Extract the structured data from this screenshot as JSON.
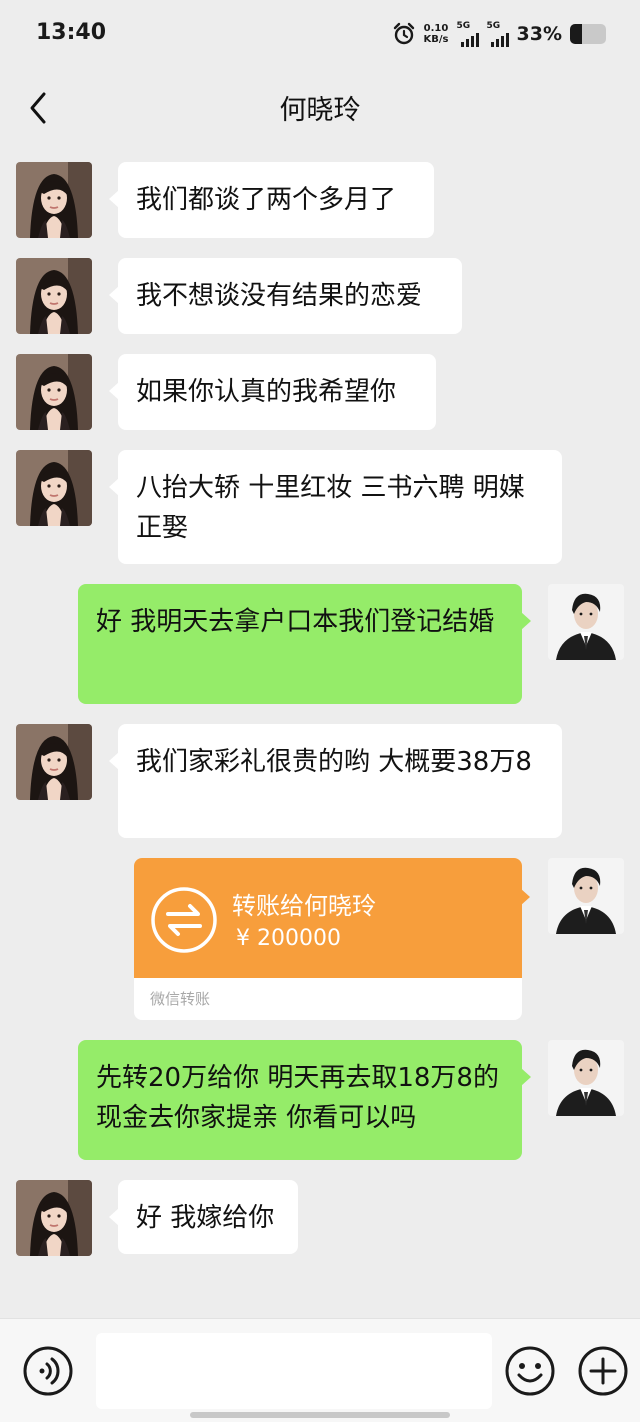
{
  "status_bar": {
    "time": "13:40",
    "net_speed_value": "0.10",
    "net_speed_unit": "KB/s",
    "signal1_label": "5G",
    "signal2_label": "5G",
    "battery_percent": "33%",
    "battery_level": 0.33
  },
  "nav": {
    "title": "何晓玲",
    "back_icon": "chevron-left-icon"
  },
  "messages": [
    {
      "side": "in",
      "text": "我们都谈了两个多月了"
    },
    {
      "side": "in",
      "text": "我不想谈没有结果的恋爱"
    },
    {
      "side": "in",
      "text": "如果你认真的我希望你"
    },
    {
      "side": "in",
      "text": "八抬大轿 十里红妆 三书六聘 明媒正娶"
    },
    {
      "side": "out",
      "text": "好 我明天去拿户口本我们登记结婚"
    },
    {
      "side": "in",
      "text": "我们家彩礼很贵的哟 大概要38万8"
    },
    {
      "side": "out",
      "type": "transfer"
    },
    {
      "side": "out",
      "text": "先转20万给你 明天再去取18万8的现金去你家提亲 你看可以吗"
    },
    {
      "side": "in",
      "text": "好 我嫁给你"
    }
  ],
  "transfer": {
    "title": "转账给何晓玲",
    "amount": "¥ 200000",
    "footer": "微信转账",
    "icon": "transfer-arrows-icon"
  },
  "input_bar": {
    "voice_icon": "voice-icon",
    "emoji_icon": "emoji-icon",
    "plus_icon": "plus-icon",
    "placeholder": ""
  },
  "colors": {
    "background": "#ededed",
    "incoming_bubble": "#ffffff",
    "outgoing_bubble": "#95ec69",
    "transfer_card": "#f79e3c"
  }
}
